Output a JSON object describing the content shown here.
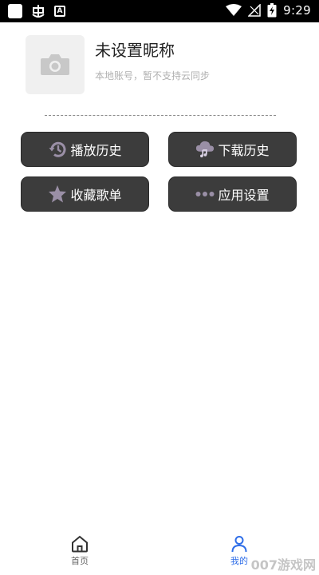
{
  "status_bar": {
    "time": "9:29",
    "icons": [
      "app-square-icon",
      "bug-icon",
      "a-notification-icon",
      "wifi-icon",
      "signal-icon",
      "battery-charging-icon"
    ]
  },
  "profile": {
    "nickname": "未设置昵称",
    "account_note": "本地账号，暂不支持云同步",
    "avatar_icon": "camera-icon"
  },
  "menu": {
    "play_history": {
      "label": "播放历史",
      "icon": "history-icon"
    },
    "download_history": {
      "label": "下载历史",
      "icon": "cloud-music-icon"
    },
    "favorite_playlists": {
      "label": "收藏歌单",
      "icon": "star-icon"
    },
    "app_settings": {
      "label": "应用设置",
      "icon": "more-dots-icon"
    }
  },
  "bottom_nav": {
    "home": {
      "label": "首页",
      "icon": "home-icon"
    },
    "mine": {
      "label": "我的",
      "icon": "person-icon",
      "active": true
    }
  },
  "watermark": "007游戏网",
  "colors": {
    "button_bg": "#3c3c3c",
    "button_icon": "#9a8fa6",
    "active_nav": "#2f6ee8"
  }
}
